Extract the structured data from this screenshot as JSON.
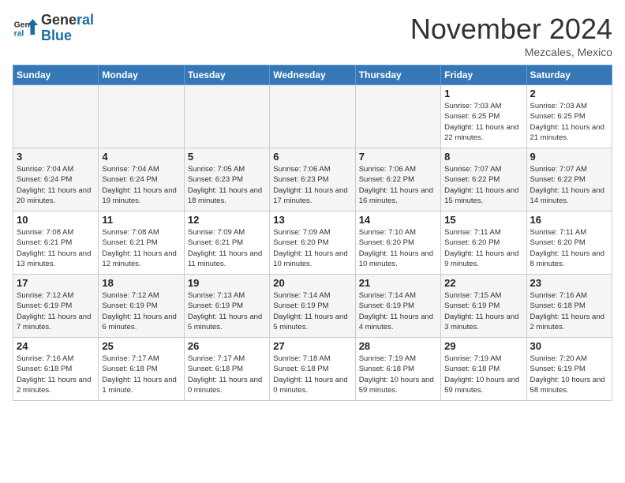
{
  "header": {
    "logo_line1": "General",
    "logo_line2": "Blue",
    "month": "November 2024",
    "location": "Mezcales, Mexico"
  },
  "days_of_week": [
    "Sunday",
    "Monday",
    "Tuesday",
    "Wednesday",
    "Thursday",
    "Friday",
    "Saturday"
  ],
  "weeks": [
    [
      {
        "day": "",
        "info": "",
        "empty": true
      },
      {
        "day": "",
        "info": "",
        "empty": true
      },
      {
        "day": "",
        "info": "",
        "empty": true
      },
      {
        "day": "",
        "info": "",
        "empty": true
      },
      {
        "day": "",
        "info": "",
        "empty": true
      },
      {
        "day": "1",
        "info": "Sunrise: 7:03 AM\nSunset: 6:25 PM\nDaylight: 11 hours and 22 minutes."
      },
      {
        "day": "2",
        "info": "Sunrise: 7:03 AM\nSunset: 6:25 PM\nDaylight: 11 hours and 21 minutes."
      }
    ],
    [
      {
        "day": "3",
        "info": "Sunrise: 7:04 AM\nSunset: 6:24 PM\nDaylight: 11 hours and 20 minutes."
      },
      {
        "day": "4",
        "info": "Sunrise: 7:04 AM\nSunset: 6:24 PM\nDaylight: 11 hours and 19 minutes."
      },
      {
        "day": "5",
        "info": "Sunrise: 7:05 AM\nSunset: 6:23 PM\nDaylight: 11 hours and 18 minutes."
      },
      {
        "day": "6",
        "info": "Sunrise: 7:06 AM\nSunset: 6:23 PM\nDaylight: 11 hours and 17 minutes."
      },
      {
        "day": "7",
        "info": "Sunrise: 7:06 AM\nSunset: 6:22 PM\nDaylight: 11 hours and 16 minutes."
      },
      {
        "day": "8",
        "info": "Sunrise: 7:07 AM\nSunset: 6:22 PM\nDaylight: 11 hours and 15 minutes."
      },
      {
        "day": "9",
        "info": "Sunrise: 7:07 AM\nSunset: 6:22 PM\nDaylight: 11 hours and 14 minutes."
      }
    ],
    [
      {
        "day": "10",
        "info": "Sunrise: 7:08 AM\nSunset: 6:21 PM\nDaylight: 11 hours and 13 minutes."
      },
      {
        "day": "11",
        "info": "Sunrise: 7:08 AM\nSunset: 6:21 PM\nDaylight: 11 hours and 12 minutes."
      },
      {
        "day": "12",
        "info": "Sunrise: 7:09 AM\nSunset: 6:21 PM\nDaylight: 11 hours and 11 minutes."
      },
      {
        "day": "13",
        "info": "Sunrise: 7:09 AM\nSunset: 6:20 PM\nDaylight: 11 hours and 10 minutes."
      },
      {
        "day": "14",
        "info": "Sunrise: 7:10 AM\nSunset: 6:20 PM\nDaylight: 11 hours and 10 minutes."
      },
      {
        "day": "15",
        "info": "Sunrise: 7:11 AM\nSunset: 6:20 PM\nDaylight: 11 hours and 9 minutes."
      },
      {
        "day": "16",
        "info": "Sunrise: 7:11 AM\nSunset: 6:20 PM\nDaylight: 11 hours and 8 minutes."
      }
    ],
    [
      {
        "day": "17",
        "info": "Sunrise: 7:12 AM\nSunset: 6:19 PM\nDaylight: 11 hours and 7 minutes."
      },
      {
        "day": "18",
        "info": "Sunrise: 7:12 AM\nSunset: 6:19 PM\nDaylight: 11 hours and 6 minutes."
      },
      {
        "day": "19",
        "info": "Sunrise: 7:13 AM\nSunset: 6:19 PM\nDaylight: 11 hours and 5 minutes."
      },
      {
        "day": "20",
        "info": "Sunrise: 7:14 AM\nSunset: 6:19 PM\nDaylight: 11 hours and 5 minutes."
      },
      {
        "day": "21",
        "info": "Sunrise: 7:14 AM\nSunset: 6:19 PM\nDaylight: 11 hours and 4 minutes."
      },
      {
        "day": "22",
        "info": "Sunrise: 7:15 AM\nSunset: 6:19 PM\nDaylight: 11 hours and 3 minutes."
      },
      {
        "day": "23",
        "info": "Sunrise: 7:16 AM\nSunset: 6:18 PM\nDaylight: 11 hours and 2 minutes."
      }
    ],
    [
      {
        "day": "24",
        "info": "Sunrise: 7:16 AM\nSunset: 6:18 PM\nDaylight: 11 hours and 2 minutes."
      },
      {
        "day": "25",
        "info": "Sunrise: 7:17 AM\nSunset: 6:18 PM\nDaylight: 11 hours and 1 minute."
      },
      {
        "day": "26",
        "info": "Sunrise: 7:17 AM\nSunset: 6:18 PM\nDaylight: 11 hours and 0 minutes."
      },
      {
        "day": "27",
        "info": "Sunrise: 7:18 AM\nSunset: 6:18 PM\nDaylight: 11 hours and 0 minutes."
      },
      {
        "day": "28",
        "info": "Sunrise: 7:19 AM\nSunset: 6:18 PM\nDaylight: 10 hours and 59 minutes."
      },
      {
        "day": "29",
        "info": "Sunrise: 7:19 AM\nSunset: 6:18 PM\nDaylight: 10 hours and 59 minutes."
      },
      {
        "day": "30",
        "info": "Sunrise: 7:20 AM\nSunset: 6:19 PM\nDaylight: 10 hours and 58 minutes."
      }
    ]
  ]
}
